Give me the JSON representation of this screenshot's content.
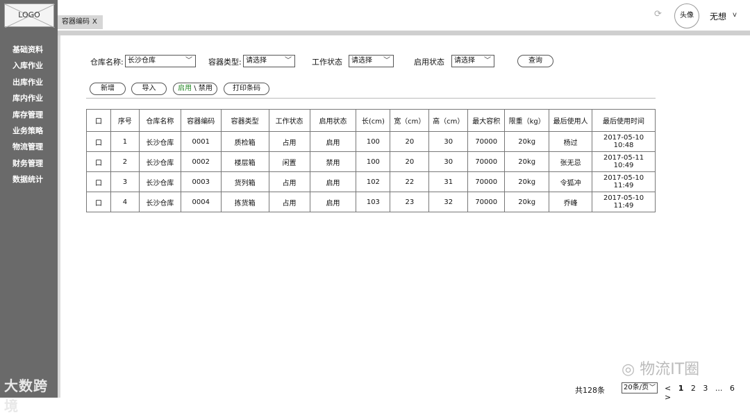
{
  "app": {
    "logo_text": "LOGO",
    "watermark_text": "大数跨境"
  },
  "sidebar": {
    "items": [
      {
        "label": "基础资料"
      },
      {
        "label": "入库作业"
      },
      {
        "label": "出库作业"
      },
      {
        "label": "库内作业"
      },
      {
        "label": "库存管理"
      },
      {
        "label": "业务策略"
      },
      {
        "label": "物流管理"
      },
      {
        "label": "财务管理"
      },
      {
        "label": "数据统计"
      }
    ]
  },
  "tabs": [
    {
      "label": "容器编码",
      "close": "X"
    }
  ],
  "header": {
    "refresh_icon": "refresh-icon",
    "avatar_label": "头像",
    "username": "无想",
    "user_caret": "v"
  },
  "filters": {
    "warehouse_label": "仓库名称:",
    "warehouse_value": "长沙仓库",
    "container_type_label": "容器类型:",
    "container_type_value": "请选择",
    "work_status_label": "工作状态",
    "work_status_value": "请选择",
    "enable_status_label": "启用状态",
    "enable_status_value": "请选择",
    "query_button": "查询",
    "caret": "﹀"
  },
  "toolbar": {
    "add": "新增",
    "import": "导入",
    "enable": "启用",
    "separator": "\\",
    "disable": "禁用",
    "print": "打印条码"
  },
  "table": {
    "headers": [
      "口",
      "序号",
      "仓库名称",
      "容器编码",
      "容器类型",
      "工作状态",
      "启用状态",
      "长(cm)",
      "宽（cm）",
      "高（cm）",
      "最大容积",
      "限重（kg）",
      "最后使用人",
      "最后使用时间"
    ],
    "rows": [
      [
        "口",
        "1",
        "长沙仓库",
        "0001",
        "质检箱",
        "占用",
        "启用",
        "100",
        "20",
        "30",
        "70000",
        "20kg",
        "杨过",
        "2017-05-10 10:48"
      ],
      [
        "口",
        "2",
        "长沙仓库",
        "0002",
        "楼层箱",
        "闲置",
        "禁用",
        "100",
        "20",
        "30",
        "70000",
        "20kg",
        "张无忌",
        "2017-05-11 10:49"
      ],
      [
        "口",
        "3",
        "长沙仓库",
        "0003",
        "货列箱",
        "占用",
        "启用",
        "102",
        "22",
        "31",
        "70000",
        "20kg",
        "令狐冲",
        "2017-05-10 11:49"
      ],
      [
        "口",
        "4",
        "长沙仓库",
        "0004",
        "拣货箱",
        "占用",
        "启用",
        "103",
        "23",
        "32",
        "70000",
        "20kg",
        "乔峰",
        "2017-05-10 11:49"
      ]
    ]
  },
  "footer": {
    "brand": "物流IT圈",
    "total": "共128条",
    "page_size": "20条/页",
    "pages": [
      "<",
      "1",
      "2",
      "3",
      "...",
      "6",
      ">"
    ],
    "current_page": "1"
  }
}
